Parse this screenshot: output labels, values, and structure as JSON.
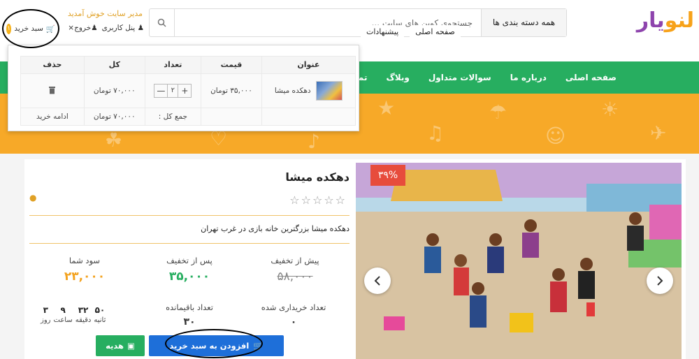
{
  "header": {
    "logo_part1": "لنو",
    "logo_part2": "یار",
    "category_select": "همه دسته بندی ها",
    "search_placeholder": "جستجوی کوپن های سایت ...",
    "welcome": "مدیر سایت خوش آمدید",
    "user_panel": "پنل کاربری",
    "logout": "خروج",
    "cart_label": "سبد خرید",
    "cart_count": "۱"
  },
  "nav": {
    "items": [
      "صفحه اصلی",
      "درباره ما",
      "سوالات متداول",
      "وبلاگ",
      "تماس با ما"
    ]
  },
  "breadcrumb": [
    "صفحه اصلی",
    "پیشنهادات"
  ],
  "cart_popup": {
    "headers": [
      "عنوان",
      "قیمت",
      "تعداد",
      "کل",
      "حذف"
    ],
    "item": {
      "title": "دهکده میشا",
      "price": "۳۵,۰۰۰ تومان",
      "qty": "۲",
      "total": "۷۰,۰۰۰ تومان"
    },
    "sum_label": "جمع کل :",
    "sum_value": "۷۰,۰۰۰ تومان",
    "continue": "ادامه خرید"
  },
  "product": {
    "discount_badge": "۳۹%",
    "title": "دهکده میشا",
    "description": "دهکده میشا بزرگترین خانه بازی در غرب تهران",
    "rating": 0,
    "stats": {
      "before_label": "پیش از تخفیف",
      "before_value": "۵۸,۰۰۰",
      "after_label": "پس از تخفیف",
      "after_value": "۳۵,۰۰۰",
      "profit_label": "سود شما",
      "profit_value": "۲۳,۰۰۰",
      "bought_label": "تعداد خریداری شده",
      "bought_value": "۰",
      "remaining_label": "تعداد باقیمانده",
      "remaining_value": "۳۰"
    },
    "countdown": {
      "days": "۳",
      "hours": "۹",
      "minutes": "۳۲",
      "seconds": "۵۰",
      "days_label": "روز",
      "hours_label": "ساعت",
      "minutes_label": "دقیقه",
      "seconds_label": "ثانیه"
    },
    "add_to_cart": "افزودن به سبد خرید",
    "gift": "هدیه"
  },
  "colors": {
    "green": "#27ae60",
    "orange": "#f7a928",
    "blue": "#1e6fd9",
    "red": "#e74c3c",
    "gold": "#e0a126"
  }
}
